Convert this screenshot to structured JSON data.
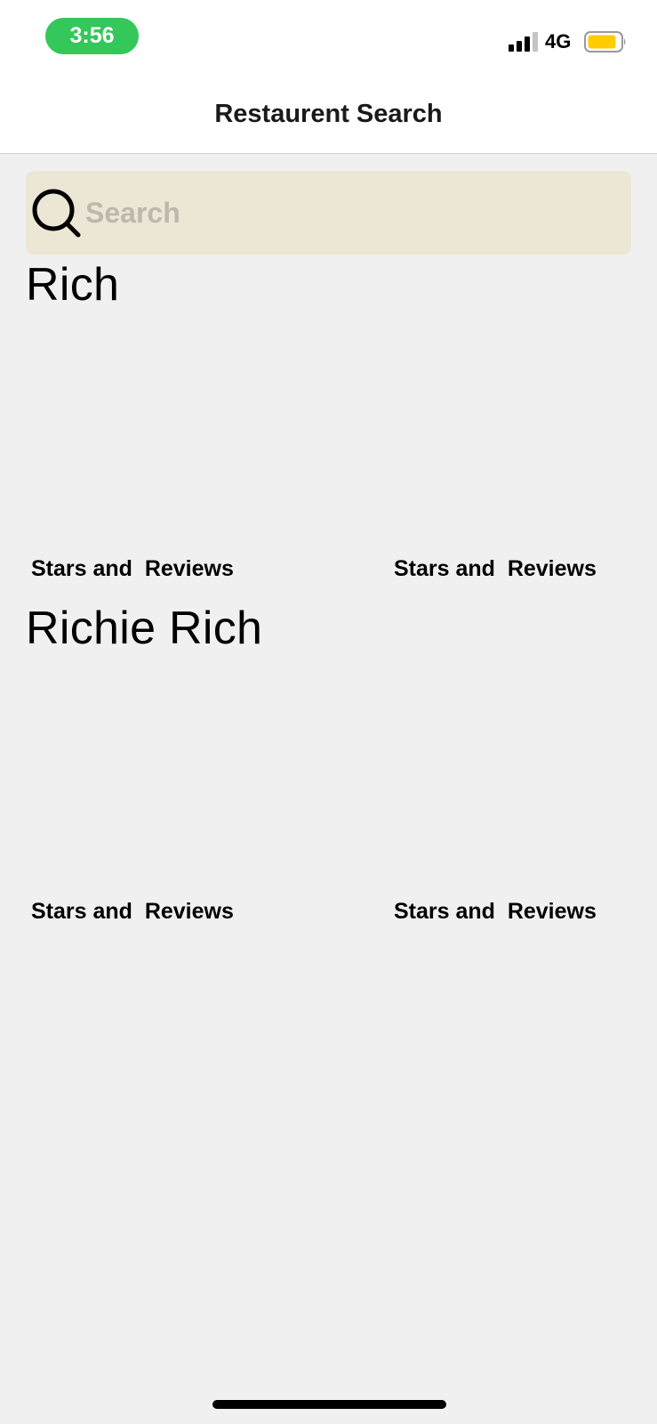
{
  "status_bar": {
    "time": "3:56",
    "network": "4G",
    "colors": {
      "time_pill": "#34c759",
      "battery_fill": "#ffcc00"
    }
  },
  "nav": {
    "title": "Restaurent Search"
  },
  "search": {
    "placeholder": "Search"
  },
  "results": [
    {
      "title": "Rich",
      "ratings": [
        "Stars and  Reviews",
        "Stars and  Reviews"
      ]
    },
    {
      "title": "Richie Rich",
      "ratings": [
        "Stars and  Reviews",
        "Stars and  Reviews"
      ]
    }
  ],
  "icons": {
    "signal": "signal-icon",
    "battery": "battery-icon",
    "search": "search-icon"
  }
}
